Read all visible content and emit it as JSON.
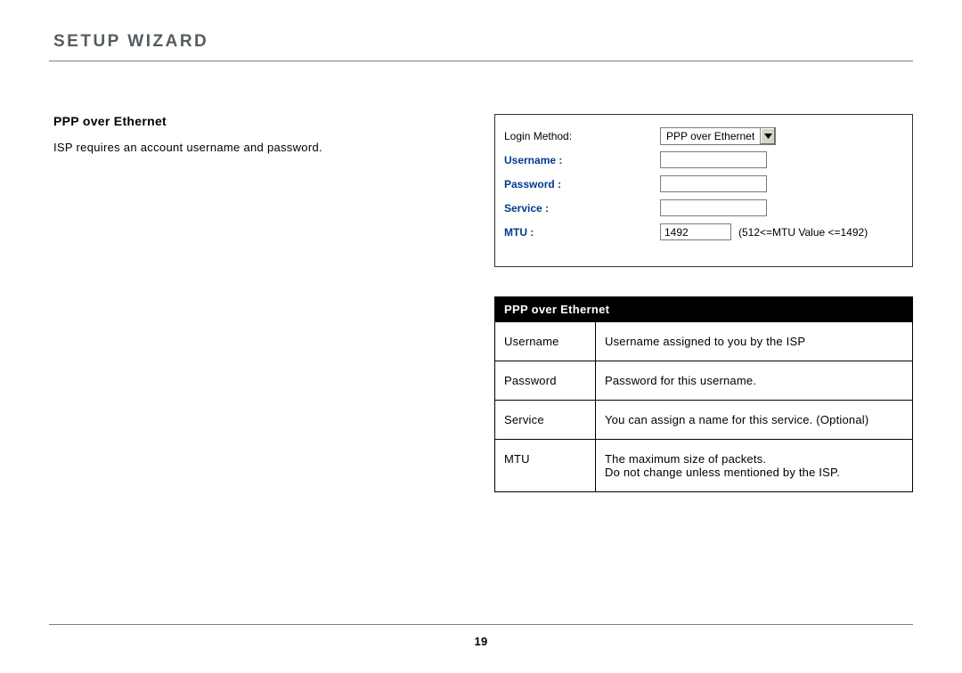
{
  "header": {
    "title": "SETUP WIZARD"
  },
  "left": {
    "heading": "PPP over Ethernet",
    "description": "ISP requires an account username and password."
  },
  "config": {
    "login_method_label": "Login Method:",
    "login_method_value": "PPP over Ethernet",
    "username_label": "Username :",
    "username_value": "",
    "password_label": "Password :",
    "password_value": "",
    "service_label": "Service :",
    "service_value": "",
    "mtu_label": "MTU :",
    "mtu_value": "1492",
    "mtu_hint": "(512<=MTU Value <=1492)"
  },
  "table": {
    "header": "PPP over Ethernet",
    "rows": [
      {
        "key": "Username",
        "val": "Username assigned to you by the ISP"
      },
      {
        "key": "Password",
        "val": "Password for this username."
      },
      {
        "key": "Service",
        "val": "You can assign a name for this service. (Optional)"
      },
      {
        "key": "MTU",
        "val": "The maximum size of packets.\nDo not change unless mentioned by the ISP."
      }
    ]
  },
  "page_number": "19"
}
